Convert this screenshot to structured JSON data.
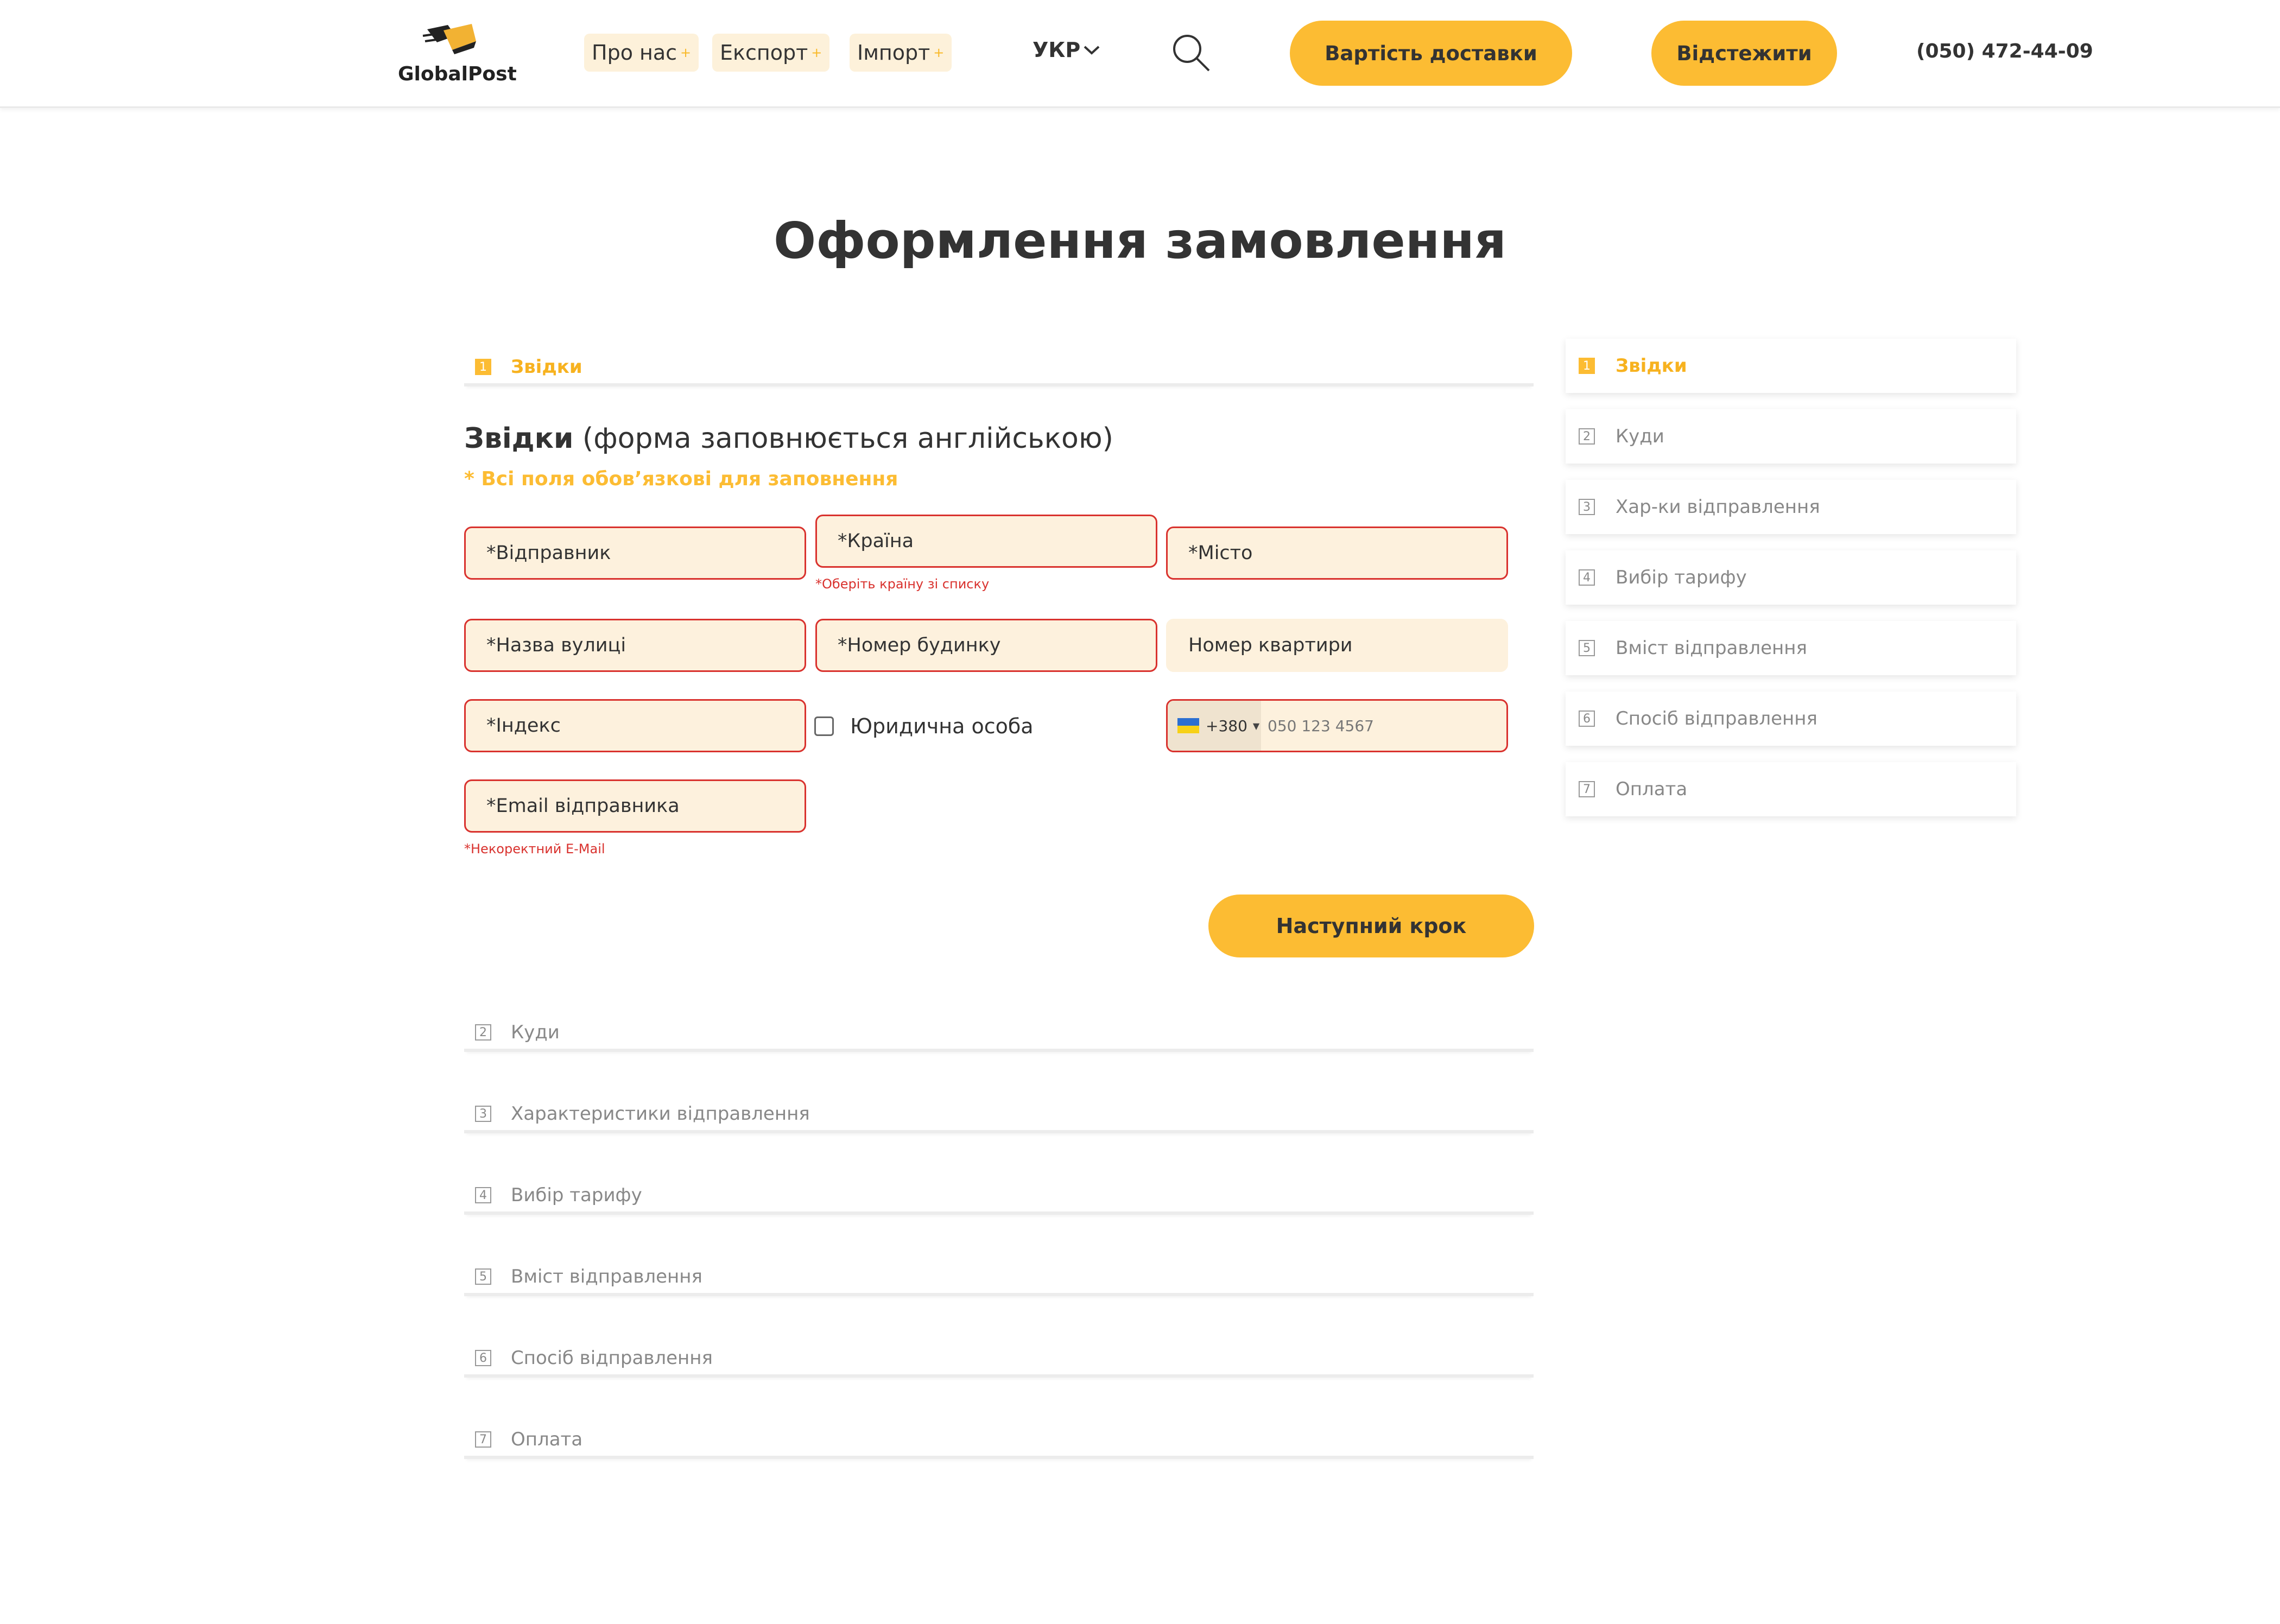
{
  "header": {
    "logo_text": "GlobalPost",
    "nav": [
      {
        "label": "Про нас",
        "plus": "+"
      },
      {
        "label": "Експорт",
        "plus": "+"
      },
      {
        "label": "Імпорт",
        "plus": "+"
      }
    ],
    "language": "УКР",
    "search_icon": "search-icon",
    "cost_button": "Вартість доставки",
    "track_button": "Відстежити",
    "phone": "(050) 472-44-09"
  },
  "page_title": "Оформлення замовлення",
  "steps": [
    {
      "num": "1",
      "label": "Звідки",
      "active": true
    },
    {
      "num": "2",
      "label": "Куди"
    },
    {
      "num": "3",
      "label": "Характеристики відправлення"
    },
    {
      "num": "4",
      "label": "Вибір тарифу"
    },
    {
      "num": "5",
      "label": "Вміст відправлення"
    },
    {
      "num": "6",
      "label": "Спосіб відправлення"
    },
    {
      "num": "7",
      "label": "Оплата"
    }
  ],
  "form": {
    "title_bold": "Звідки",
    "title_rest": " (форма заповнюється англійською)",
    "required_note": "* Всі поля обов’язкові для заповнення",
    "sender": "*Відправник",
    "country": "*Країна",
    "country_error": "*Оберіть країну зі списку",
    "city": "*Місто",
    "street": "*Назва вулиці",
    "house": "*Номер будинку",
    "apartment": "Номер квартири",
    "index": "*Індекс",
    "legal_entity": "Юридична особа",
    "phone_code": "+380",
    "phone_placeholder": "050 123 4567",
    "email": "*Email відправника",
    "email_error": "*Некоректний E-Mail",
    "next_button": "Наступний крок"
  },
  "sidebar": [
    {
      "num": "1",
      "label": "Звідки",
      "active": true
    },
    {
      "num": "2",
      "label": "Куди"
    },
    {
      "num": "3",
      "label": "Хар-ки відправлення"
    },
    {
      "num": "4",
      "label": "Вибір тарифу"
    },
    {
      "num": "5",
      "label": "Вміст відправлення"
    },
    {
      "num": "6",
      "label": "Спосіб відправлення"
    },
    {
      "num": "7",
      "label": "Оплата"
    }
  ],
  "colors": {
    "accent": "#fcbc33",
    "error": "#d9322e",
    "field_bg": "#fdf1dd"
  }
}
